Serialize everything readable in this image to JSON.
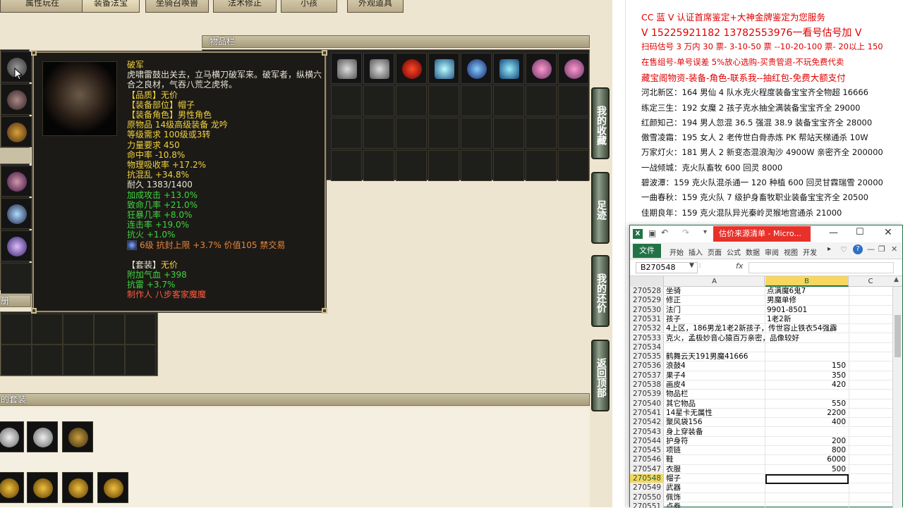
{
  "game": {
    "tabs": [
      "属性玩在",
      "装备法宝",
      "坐骑召唤兽",
      "法术修正",
      "小孩",
      "外观道具"
    ],
    "inventory_title": "物品栏",
    "set_title": "的套装",
    "cut_label": "册",
    "side_buttons": [
      "我的收藏",
      "足迹",
      "我的还价",
      "返回顶部"
    ],
    "tooltip": {
      "name": "破军",
      "lines": [
        {
          "text": "虎啸雷鼓出关去，立马横刀破军来。破军者，纵横六合之良材，气吞八荒之虎将。",
          "color": "white"
        },
        {
          "text": "【品质】无价",
          "color": "yellow"
        },
        {
          "text": "【装备部位】帽子",
          "color": "yellow"
        },
        {
          "text": "【装备角色】男性角色",
          "color": "yellow"
        },
        {
          "text": "原物品 14级高级装备 龙吟",
          "color": "yellow"
        },
        {
          "text": "等级需求 100级或3转",
          "color": "yellow"
        },
        {
          "text": "力量要求 450",
          "color": "yellow"
        },
        {
          "text": "命中率 -10.8%",
          "color": "yellow"
        },
        {
          "text": "物理吸收率 +17.2%",
          "color": "yellow"
        },
        {
          "text": "抗混乱 +34.8%",
          "color": "yellow"
        },
        {
          "text": "耐久 1383/1400",
          "color": "white"
        },
        {
          "text": "加成攻击 +13.0%",
          "color": "green"
        },
        {
          "text": "致命几率 +21.0%",
          "color": "green"
        },
        {
          "text": "狂暴几率 +8.0%",
          "color": "green"
        },
        {
          "text": "连击率 +19.0%",
          "color": "green"
        },
        {
          "text": "抗火 +1.0%",
          "color": "green"
        }
      ],
      "gem_line": "6级 抗封上限 +3.7% 价值105 禁交易",
      "set_label": "【套装】",
      "set_value": "无价",
      "set_lines": [
        "附加气血 +398",
        "抗雷 +3.7%"
      ],
      "maker": "制作人 八步客家魔魔"
    }
  },
  "notes": {
    "red_lines": [
      "CC 蓝 V 认证首席鉴定+大神金牌鉴定为您服务",
      "V 15225921182     13782553976一看号估号加 V",
      "扫码估号 3 万内 30 票- 3-10-50 票  --10-20-100 票- 20以上 150",
      "在售组号-单号误差 5%放心选购-买贵管退-不玩免费代卖",
      "藏宝阁物资-装备-角色-联系我--抽红包-免费大额支付"
    ],
    "black_lines": [
      "河北新区：164 男仙 4 队水克火程度装备宝宝齐全物超 16666",
      "练定三生：192 女魔 2 孩子克水抽全满装备宝宝齐全 29000",
      "红颜知己：194 男人忽混 36.5 强混 38.9 装备宝宝齐全 28000",
      "傲雪凌霜：195 女人 2 老传世白骨赤炼 PK 帮站天梯通杀 10W",
      "万家灯火：181 男人 2 新变态混浪淘沙 4900W 亲密齐全 200000",
      "一战倾城：克火队畜牧 600 回灵 8000",
      "碧波潭：159 克火队混杀通一 120 种植 600 回灵甘霖瑞雪 20000",
      "一曲春秋：159 克火队 7 级护身畜牧职业装备宝宝齐全 20500",
      "佳期良年：159 克火混队异光秦岭灵猴地宫通杀 21000"
    ]
  },
  "excel": {
    "title": "估价来源清单 - Micro...",
    "file_tab": "文件",
    "ribbon_tabs": [
      "开始",
      "插入",
      "页面",
      "公式",
      "数据",
      "审阅",
      "视图",
      "开发"
    ],
    "name_box": "B270548",
    "fx": "fx",
    "columns": [
      "A",
      "B",
      "C"
    ],
    "rows": [
      {
        "n": "270528",
        "a": "坐骑",
        "b": "点满魔6鬼7",
        "b_align": "left"
      },
      {
        "n": "270529",
        "a": "修正",
        "b": "男魔单修",
        "b_align": "left"
      },
      {
        "n": "270530",
        "a": "法门",
        "b": "9901-8501",
        "b_align": "left"
      },
      {
        "n": "270531",
        "a": "孩子",
        "b": "1老2新",
        "b_align": "left"
      },
      {
        "n": "270532",
        "a": "4上区，186男龙1老2新孩子，传世容止铁衣54强霹",
        "b": "",
        "b_align": "left"
      },
      {
        "n": "270533",
        "a": "克火，孟极妙音心猿百万亲密，品像较好",
        "b": "",
        "b_align": "left"
      },
      {
        "n": "270534",
        "a": "",
        "b": "",
        "b_align": "left"
      },
      {
        "n": "270535",
        "a": "鹤舞云天191男魔41666",
        "b": "",
        "b_align": "left"
      },
      {
        "n": "270536",
        "a": "浪鼓4",
        "b": "150",
        "b_align": "right"
      },
      {
        "n": "270537",
        "a": "果子4",
        "b": "350",
        "b_align": "right"
      },
      {
        "n": "270538",
        "a": "画皮4",
        "b": "420",
        "b_align": "right"
      },
      {
        "n": "270539",
        "a": "物品栏",
        "b": "",
        "b_align": "right"
      },
      {
        "n": "270540",
        "a": "其它物品",
        "b": "550",
        "b_align": "right"
      },
      {
        "n": "270541",
        "a": "14星卡无属性",
        "b": "2200",
        "b_align": "right"
      },
      {
        "n": "270542",
        "a": "聚风袋156",
        "b": "400",
        "b_align": "right"
      },
      {
        "n": "270543",
        "a": "身上穿装备",
        "b": "",
        "b_align": "right"
      },
      {
        "n": "270544",
        "a": "护身符",
        "b": "200",
        "b_align": "right"
      },
      {
        "n": "270545",
        "a": "项链",
        "b": "800",
        "b_align": "right"
      },
      {
        "n": "270546",
        "a": "鞋",
        "b": "6000",
        "b_align": "right"
      },
      {
        "n": "270547",
        "a": "衣服",
        "b": "500",
        "b_align": "right"
      },
      {
        "n": "270548",
        "a": "帽子",
        "b": "",
        "b_align": "right",
        "selected": true
      },
      {
        "n": "270549",
        "a": "武器",
        "b": "",
        "b_align": "right"
      },
      {
        "n": "270550",
        "a": "佩饰",
        "b": "",
        "b_align": "right"
      },
      {
        "n": "270551",
        "a": "点券",
        "b": "",
        "b_align": "right"
      }
    ]
  },
  "colors": {
    "excel_green": "#217346",
    "title_red": "#e8312a",
    "note_red": "#e00000",
    "tooltip_yellow": "#f2d23c",
    "tooltip_green": "#3fd63f"
  }
}
